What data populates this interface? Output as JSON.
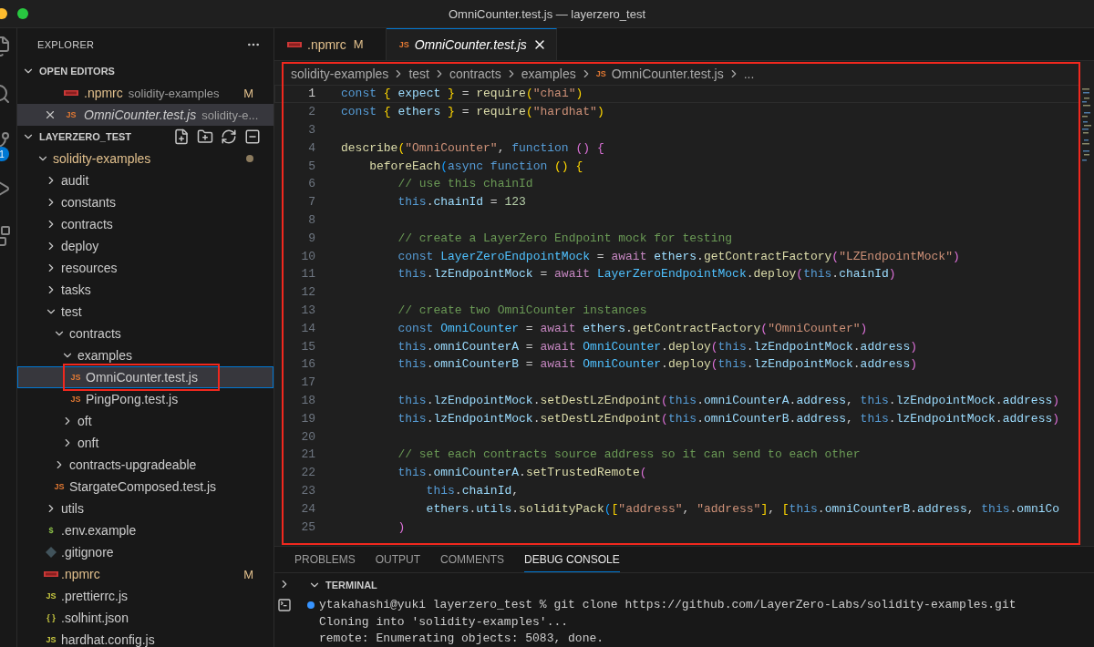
{
  "window": {
    "title": "OmniCounter.test.js — layerzero_test"
  },
  "activity_bar": {
    "badge": "1"
  },
  "sidebar": {
    "title": "EXPLORER",
    "open_editors": {
      "label": "OPEN EDITORS",
      "expanded": true,
      "items": [
        {
          "label": ".npmrc",
          "description": "solidity-examples",
          "kind": "npm",
          "badge": "M",
          "modified": true,
          "preview": false,
          "selected": false
        },
        {
          "label": "OmniCounter.test.js",
          "description": "solidity-e...",
          "kind": "js",
          "glyph": "JS",
          "modified": false,
          "preview": true,
          "selected": true
        }
      ]
    },
    "workspace": {
      "label": "LAYERZERO_TEST",
      "expanded": true,
      "tree": [
        {
          "label": "solidity-examples",
          "kind": "folder",
          "expanded": true,
          "modified": true,
          "selected": false,
          "children": [
            {
              "label": "audit",
              "kind": "folder",
              "expanded": false,
              "selected": false
            },
            {
              "label": "constants",
              "kind": "folder",
              "expanded": false,
              "selected": false
            },
            {
              "label": "contracts",
              "kind": "folder",
              "expanded": false,
              "selected": false
            },
            {
              "label": "deploy",
              "kind": "folder",
              "expanded": false,
              "selected": false
            },
            {
              "label": "resources",
              "kind": "folder",
              "expanded": false,
              "selected": false
            },
            {
              "label": "tasks",
              "kind": "folder",
              "expanded": false,
              "selected": false
            },
            {
              "label": "test",
              "kind": "folder",
              "expanded": true,
              "selected": false,
              "children": [
                {
                  "label": "contracts",
                  "kind": "folder",
                  "expanded": true,
                  "selected": false,
                  "children": [
                    {
                      "label": "examples",
                      "kind": "folder",
                      "expanded": true,
                      "selected": false,
                      "children": [
                        {
                          "label": "OmniCounter.test.js",
                          "kind": "js",
                          "glyph": "JS",
                          "selected": true,
                          "highlighted": true
                        },
                        {
                          "label": "PingPong.test.js",
                          "kind": "js",
                          "glyph": "JS",
                          "selected": false
                        }
                      ]
                    },
                    {
                      "label": "oft",
                      "kind": "folder",
                      "expanded": false,
                      "selected": false
                    },
                    {
                      "label": "onft",
                      "kind": "folder",
                      "expanded": false,
                      "selected": false
                    }
                  ]
                },
                {
                  "label": "contracts-upgradeable",
                  "kind": "folder",
                  "expanded": false,
                  "selected": false
                },
                {
                  "label": "StargateComposed.test.js",
                  "kind": "js",
                  "glyph": "JS",
                  "selected": false
                }
              ]
            },
            {
              "label": "utils",
              "kind": "folder",
              "expanded": false,
              "selected": false
            },
            {
              "label": ".env.example",
              "kind": "env",
              "glyph": "$",
              "selected": false
            },
            {
              "label": ".gitignore",
              "kind": "git",
              "selected": false
            },
            {
              "label": ".npmrc",
              "kind": "npm",
              "badge": "M",
              "modified": true,
              "selected": false
            },
            {
              "label": ".prettierrc.js",
              "kind": "config",
              "glyph": "JS",
              "selected": false
            },
            {
              "label": ".solhint.json",
              "kind": "json",
              "glyph": "{ }",
              "selected": false
            },
            {
              "label": "hardhat.config.js",
              "kind": "config",
              "glyph": "JS",
              "selected": false
            }
          ]
        }
      ]
    }
  },
  "editor": {
    "highlighted": true,
    "tabs": [
      {
        "label": ".npmrc",
        "kind": "npm",
        "badge": "M",
        "modified": true,
        "preview": false,
        "selected": false
      },
      {
        "label": "OmniCounter.test.js",
        "kind": "js",
        "glyph": "JS",
        "modified": false,
        "preview": true,
        "selected": true
      }
    ],
    "breadcrumb": [
      {
        "label": "solidity-examples"
      },
      {
        "label": "test"
      },
      {
        "label": "contracts"
      },
      {
        "label": "examples"
      },
      {
        "label": "OmniCounter.test.js",
        "kind": "js",
        "glyph": "JS"
      },
      {
        "label": "..."
      }
    ],
    "lines": [
      {
        "number": "1",
        "active": true,
        "tokens": [
          {
            "text": "const ",
            "kind": "kw"
          },
          {
            "text": "{",
            "kind": "b1"
          },
          {
            "text": " expect ",
            "kind": "var"
          },
          {
            "text": "}",
            "kind": "b1"
          },
          {
            "text": " = ",
            "kind": "p"
          },
          {
            "text": "require",
            "kind": "fn"
          },
          {
            "text": "(",
            "kind": "b1"
          },
          {
            "text": "\"chai\"",
            "kind": "str"
          },
          {
            "text": ")",
            "kind": "b1"
          }
        ]
      },
      {
        "number": "2",
        "active": false,
        "tokens": [
          {
            "text": "const ",
            "kind": "kw"
          },
          {
            "text": "{",
            "kind": "b1"
          },
          {
            "text": " ethers ",
            "kind": "var"
          },
          {
            "text": "}",
            "kind": "b1"
          },
          {
            "text": " = ",
            "kind": "p"
          },
          {
            "text": "require",
            "kind": "fn"
          },
          {
            "text": "(",
            "kind": "b1"
          },
          {
            "text": "\"hardhat\"",
            "kind": "str"
          },
          {
            "text": ")",
            "kind": "b1"
          }
        ]
      },
      {
        "number": "3",
        "active": false
      },
      {
        "number": "4",
        "active": false,
        "tokens": [
          {
            "text": "describe",
            "kind": "fn"
          },
          {
            "text": "(",
            "kind": "b1"
          },
          {
            "text": "\"OmniCounter\"",
            "kind": "str"
          },
          {
            "text": ", ",
            "kind": "p"
          },
          {
            "text": "function ",
            "kind": "kw"
          },
          {
            "text": "() ",
            "kind": "b2"
          },
          {
            "text": "{",
            "kind": "b2"
          }
        ]
      },
      {
        "number": "5",
        "active": false,
        "tokens": [
          {
            "text": "    beforeEach",
            "kind": "fn"
          },
          {
            "text": "(",
            "kind": "b3"
          },
          {
            "text": "async function ",
            "kind": "kw"
          },
          {
            "text": "() ",
            "kind": "b1"
          },
          {
            "text": "{",
            "kind": "b1"
          }
        ]
      },
      {
        "number": "6",
        "active": false,
        "tokens": [
          {
            "text": "        // use this chainId",
            "kind": "cm"
          }
        ]
      },
      {
        "number": "7",
        "active": false,
        "tokens": [
          {
            "text": "        this",
            "kind": "kw"
          },
          {
            "text": ".",
            "kind": "p"
          },
          {
            "text": "chainId",
            "kind": "var"
          },
          {
            "text": " = ",
            "kind": "p"
          },
          {
            "text": "123",
            "kind": "num"
          }
        ]
      },
      {
        "number": "8",
        "active": false
      },
      {
        "number": "9",
        "active": false,
        "tokens": [
          {
            "text": "        // create a LayerZero Endpoint mock for testing",
            "kind": "cm"
          }
        ]
      },
      {
        "number": "10",
        "active": false,
        "tokens": [
          {
            "text": "        const ",
            "kind": "kw"
          },
          {
            "text": "LayerZeroEndpointMock",
            "kind": "cls"
          },
          {
            "text": " = ",
            "kind": "p"
          },
          {
            "text": "await ",
            "kind": "ctl"
          },
          {
            "text": "ethers",
            "kind": "var"
          },
          {
            "text": ".",
            "kind": "p"
          },
          {
            "text": "getContractFactory",
            "kind": "fn"
          },
          {
            "text": "(",
            "kind": "b2"
          },
          {
            "text": "\"LZEndpointMock\"",
            "kind": "str"
          },
          {
            "text": ")",
            "kind": "b2"
          }
        ]
      },
      {
        "number": "11",
        "active": false,
        "tokens": [
          {
            "text": "        this",
            "kind": "kw"
          },
          {
            "text": ".",
            "kind": "p"
          },
          {
            "text": "lzEndpointMock",
            "kind": "var"
          },
          {
            "text": " = ",
            "kind": "p"
          },
          {
            "text": "await ",
            "kind": "ctl"
          },
          {
            "text": "LayerZeroEndpointMock",
            "kind": "cls"
          },
          {
            "text": ".",
            "kind": "p"
          },
          {
            "text": "deploy",
            "kind": "fn"
          },
          {
            "text": "(",
            "kind": "b2"
          },
          {
            "text": "this",
            "kind": "kw"
          },
          {
            "text": ".",
            "kind": "p"
          },
          {
            "text": "chainId",
            "kind": "var"
          },
          {
            "text": ")",
            "kind": "b2"
          }
        ]
      },
      {
        "number": "12",
        "active": false
      },
      {
        "number": "13",
        "active": false,
        "tokens": [
          {
            "text": "        // create two OmniCounter instances",
            "kind": "cm"
          }
        ]
      },
      {
        "number": "14",
        "active": false,
        "tokens": [
          {
            "text": "        const ",
            "kind": "kw"
          },
          {
            "text": "OmniCounter",
            "kind": "cls"
          },
          {
            "text": " = ",
            "kind": "p"
          },
          {
            "text": "await ",
            "kind": "ctl"
          },
          {
            "text": "ethers",
            "kind": "var"
          },
          {
            "text": ".",
            "kind": "p"
          },
          {
            "text": "getContractFactory",
            "kind": "fn"
          },
          {
            "text": "(",
            "kind": "b2"
          },
          {
            "text": "\"OmniCounter\"",
            "kind": "str"
          },
          {
            "text": ")",
            "kind": "b2"
          }
        ]
      },
      {
        "number": "15",
        "active": false,
        "tokens": [
          {
            "text": "        this",
            "kind": "kw"
          },
          {
            "text": ".",
            "kind": "p"
          },
          {
            "text": "omniCounterA",
            "kind": "var"
          },
          {
            "text": " = ",
            "kind": "p"
          },
          {
            "text": "await ",
            "kind": "ctl"
          },
          {
            "text": "OmniCounter",
            "kind": "cls"
          },
          {
            "text": ".",
            "kind": "p"
          },
          {
            "text": "deploy",
            "kind": "fn"
          },
          {
            "text": "(",
            "kind": "b2"
          },
          {
            "text": "this",
            "kind": "kw"
          },
          {
            "text": ".",
            "kind": "p"
          },
          {
            "text": "lzEndpointMock",
            "kind": "var"
          },
          {
            "text": ".",
            "kind": "p"
          },
          {
            "text": "address",
            "kind": "var"
          },
          {
            "text": ")",
            "kind": "b2"
          }
        ]
      },
      {
        "number": "16",
        "active": false,
        "tokens": [
          {
            "text": "        this",
            "kind": "kw"
          },
          {
            "text": ".",
            "kind": "p"
          },
          {
            "text": "omniCounterB",
            "kind": "var"
          },
          {
            "text": " = ",
            "kind": "p"
          },
          {
            "text": "await ",
            "kind": "ctl"
          },
          {
            "text": "OmniCounter",
            "kind": "cls"
          },
          {
            "text": ".",
            "kind": "p"
          },
          {
            "text": "deploy",
            "kind": "fn"
          },
          {
            "text": "(",
            "kind": "b2"
          },
          {
            "text": "this",
            "kind": "kw"
          },
          {
            "text": ".",
            "kind": "p"
          },
          {
            "text": "lzEndpointMock",
            "kind": "var"
          },
          {
            "text": ".",
            "kind": "p"
          },
          {
            "text": "address",
            "kind": "var"
          },
          {
            "text": ")",
            "kind": "b2"
          }
        ]
      },
      {
        "number": "17",
        "active": false
      },
      {
        "number": "18",
        "active": false,
        "tokens": [
          {
            "text": "        this",
            "kind": "kw"
          },
          {
            "text": ".",
            "kind": "p"
          },
          {
            "text": "lzEndpointMock",
            "kind": "var"
          },
          {
            "text": ".",
            "kind": "p"
          },
          {
            "text": "setDestLzEndpoint",
            "kind": "fn"
          },
          {
            "text": "(",
            "kind": "b2"
          },
          {
            "text": "this",
            "kind": "kw"
          },
          {
            "text": ".",
            "kind": "p"
          },
          {
            "text": "omniCounterA",
            "kind": "var"
          },
          {
            "text": ".",
            "kind": "p"
          },
          {
            "text": "address",
            "kind": "var"
          },
          {
            "text": ", ",
            "kind": "p"
          },
          {
            "text": "this",
            "kind": "kw"
          },
          {
            "text": ".",
            "kind": "p"
          },
          {
            "text": "lzEndpointMock",
            "kind": "var"
          },
          {
            "text": ".",
            "kind": "p"
          },
          {
            "text": "address",
            "kind": "var"
          },
          {
            "text": ")",
            "kind": "b2"
          }
        ]
      },
      {
        "number": "19",
        "active": false,
        "tokens": [
          {
            "text": "        this",
            "kind": "kw"
          },
          {
            "text": ".",
            "kind": "p"
          },
          {
            "text": "lzEndpointMock",
            "kind": "var"
          },
          {
            "text": ".",
            "kind": "p"
          },
          {
            "text": "setDestLzEndpoint",
            "kind": "fn"
          },
          {
            "text": "(",
            "kind": "b2"
          },
          {
            "text": "this",
            "kind": "kw"
          },
          {
            "text": ".",
            "kind": "p"
          },
          {
            "text": "omniCounterB",
            "kind": "var"
          },
          {
            "text": ".",
            "kind": "p"
          },
          {
            "text": "address",
            "kind": "var"
          },
          {
            "text": ", ",
            "kind": "p"
          },
          {
            "text": "this",
            "kind": "kw"
          },
          {
            "text": ".",
            "kind": "p"
          },
          {
            "text": "lzEndpointMock",
            "kind": "var"
          },
          {
            "text": ".",
            "kind": "p"
          },
          {
            "text": "address",
            "kind": "var"
          },
          {
            "text": ")",
            "kind": "b2"
          }
        ]
      },
      {
        "number": "20",
        "active": false
      },
      {
        "number": "21",
        "active": false,
        "tokens": [
          {
            "text": "        // set each contracts source address so it can send to each other",
            "kind": "cm"
          }
        ]
      },
      {
        "number": "22",
        "active": false,
        "tokens": [
          {
            "text": "        this",
            "kind": "kw"
          },
          {
            "text": ".",
            "kind": "p"
          },
          {
            "text": "omniCounterA",
            "kind": "var"
          },
          {
            "text": ".",
            "kind": "p"
          },
          {
            "text": "setTrustedRemote",
            "kind": "fn"
          },
          {
            "text": "(",
            "kind": "b2"
          }
        ]
      },
      {
        "number": "23",
        "active": false,
        "tokens": [
          {
            "text": "            this",
            "kind": "kw"
          },
          {
            "text": ".",
            "kind": "p"
          },
          {
            "text": "chainId",
            "kind": "var"
          },
          {
            "text": ",",
            "kind": "p"
          }
        ]
      },
      {
        "number": "24",
        "active": false,
        "tokens": [
          {
            "text": "            ethers",
            "kind": "var"
          },
          {
            "text": ".",
            "kind": "p"
          },
          {
            "text": "utils",
            "kind": "var"
          },
          {
            "text": ".",
            "kind": "p"
          },
          {
            "text": "solidityPack",
            "kind": "fn"
          },
          {
            "text": "(",
            "kind": "b3"
          },
          {
            "text": "[",
            "kind": "b1"
          },
          {
            "text": "\"address\"",
            "kind": "str"
          },
          {
            "text": ", ",
            "kind": "p"
          },
          {
            "text": "\"address\"",
            "kind": "str"
          },
          {
            "text": "]",
            "kind": "b1"
          },
          {
            "text": ", ",
            "kind": "p"
          },
          {
            "text": "[",
            "kind": "b1"
          },
          {
            "text": "this",
            "kind": "kw"
          },
          {
            "text": ".",
            "kind": "p"
          },
          {
            "text": "omniCounterB",
            "kind": "var"
          },
          {
            "text": ".",
            "kind": "p"
          },
          {
            "text": "address",
            "kind": "var"
          },
          {
            "text": ", ",
            "kind": "p"
          },
          {
            "text": "this",
            "kind": "kw"
          },
          {
            "text": ".",
            "kind": "p"
          },
          {
            "text": "omniCo",
            "kind": "var"
          }
        ]
      },
      {
        "number": "25",
        "active": false,
        "tokens": [
          {
            "text": "        )",
            "kind": "b2"
          }
        ]
      }
    ]
  },
  "panel": {
    "tabs": [
      {
        "label": "PROBLEMS",
        "selected": false
      },
      {
        "label": "OUTPUT",
        "selected": false
      },
      {
        "label": "COMMENTS",
        "selected": false
      },
      {
        "label": "DEBUG CONSOLE",
        "selected": true
      }
    ],
    "terminal": {
      "label": "TERMINAL",
      "expanded": true,
      "lines": [
        {
          "text": "ytakahashi@yuki layerzero_test % git clone https://github.com/LayerZero-Labs/solidity-examples.git",
          "prompt": true
        },
        {
          "text": "Cloning into 'solidity-examples'...",
          "prompt": false
        },
        {
          "text": "remote: Enumerating objects: 5083, done.",
          "prompt": false
        }
      ]
    }
  }
}
